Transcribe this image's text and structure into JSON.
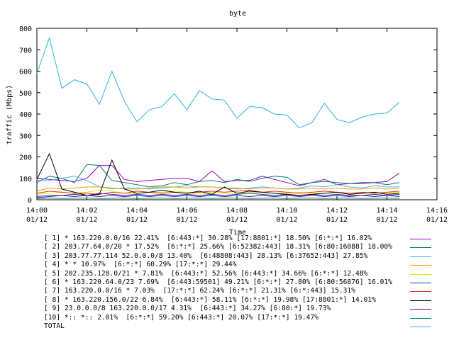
{
  "chart_data": {
    "type": "line",
    "title": "byte",
    "xlabel": "Time",
    "ylabel": "traffic (Mbps)",
    "ylim": [
      0,
      800
    ],
    "yticks": [
      "0",
      "100",
      "200",
      "300",
      "400",
      "500",
      "600",
      "700",
      "800"
    ],
    "xlim": [
      "14:00",
      "14:16"
    ],
    "xticks": [
      {
        "time": "14:00",
        "date": "01/12"
      },
      {
        "time": "14:02",
        "date": "01/12"
      },
      {
        "time": "14:04",
        "date": "01/12"
      },
      {
        "time": "14:06",
        "date": "01/12"
      },
      {
        "time": "14:08",
        "date": "01/12"
      },
      {
        "time": "14:10",
        "date": "01/12"
      },
      {
        "time": "14:12",
        "date": "01/12"
      },
      {
        "time": "14:14",
        "date": "01/12"
      },
      {
        "time": "14:16",
        "date": "01/12"
      }
    ],
    "x": [
      "14:00:00",
      "14:00:30",
      "14:01:00",
      "14:01:30",
      "14:02:00",
      "14:02:30",
      "14:03:00",
      "14:03:30",
      "14:04:00",
      "14:04:30",
      "14:05:00",
      "14:05:30",
      "14:06:00",
      "14:06:30",
      "14:07:00",
      "14:07:30",
      "14:08:00",
      "14:08:30",
      "14:09:00",
      "14:09:30",
      "14:10:00",
      "14:10:30",
      "14:11:00",
      "14:11:30",
      "14:12:00",
      "14:12:30",
      "14:13:00",
      "14:13:30",
      "14:14:00",
      "14:14:30"
    ],
    "legend_position": "bottom",
    "grid": false,
    "series": [
      {
        "name": "[ 1] * 163.220.0.0/16 22.41%  [6:443:*] 30.28% [17:8801:*] 18.50% [6:*:*] 16.02%",
        "color": "#a000c0",
        "values": [
          100,
          95,
          90,
          85,
          100,
          160,
          160,
          95,
          85,
          90,
          95,
          100,
          100,
          85,
          135,
          85,
          90,
          90,
          110,
          95,
          80,
          65,
          80,
          95,
          70,
          75,
          80,
          80,
          85,
          125
        ]
      },
      {
        "name": "[ 2] 203.77.64.0/20 * 17.52%  [6:*:*] 25.66% [6:52382:443] 18.31% [6:80:16088] 18.00%",
        "color": "#008060",
        "values": [
          80,
          110,
          100,
          80,
          165,
          160,
          90,
          80,
          70,
          60,
          65,
          80,
          70,
          85,
          90,
          80,
          95,
          85,
          100,
          110,
          105,
          70,
          80,
          85,
          80,
          75,
          75,
          80,
          70,
          80
        ]
      },
      {
        "name": "[ 3] 203.77.77.114 52.0.0.0/8 13.40%  [6:48808:443] 28.13% [6:37652:443] 27.85%",
        "color": "#50b0f0",
        "values": [
          90,
          90,
          100,
          110,
          90,
          60,
          50,
          55,
          55,
          50,
          55,
          60,
          65,
          60,
          60,
          55,
          50,
          55,
          60,
          55,
          50,
          55,
          65,
          60,
          70,
          60,
          55,
          65,
          60,
          60
        ]
      },
      {
        "name": "[ 4] * * 10.97%  [6:*:*] 60.29% [17:*:*] 29.44%",
        "color": "#f0a000",
        "values": [
          40,
          55,
          50,
          55,
          60,
          60,
          55,
          50,
          50,
          55,
          60,
          60,
          55,
          60,
          60,
          55,
          55,
          50,
          55,
          55,
          50,
          50,
          55,
          50,
          55,
          50,
          50,
          55,
          50,
          55
        ]
      },
      {
        "name": "[ 5] 202.235.128.0/21 * 7.81%  [6:443:*] 52.56% [6:443:*] 34.66% [6:*:*] 12.48%",
        "color": "#e8e800",
        "values": [
          25,
          30,
          35,
          30,
          35,
          45,
          40,
          30,
          30,
          35,
          35,
          40,
          35,
          30,
          35,
          30,
          30,
          35,
          35,
          30,
          30,
          35,
          30,
          30,
          35,
          30,
          30,
          35,
          30,
          35
        ]
      },
      {
        "name": "[ 6] * 163.220.64.0/23 7.69%  [6:443:59501] 49.21% [6:*:*] 27.80% [6:80:56876] 16.01%",
        "color": "#0050a0",
        "values": [
          15,
          20,
          20,
          25,
          20,
          30,
          25,
          20,
          25,
          20,
          25,
          20,
          25,
          20,
          25,
          20,
          25,
          30,
          25,
          20,
          25,
          20,
          25,
          20,
          25,
          20,
          20,
          25,
          20,
          25
        ]
      },
      {
        "name": "[ 7] 163.220.0.0/16 * 7.03%  [17:*:*] 62.24% [6:*:*] 21.31% [6:*:443] 15.31%",
        "color": "#e03020",
        "values": [
          30,
          40,
          35,
          30,
          30,
          25,
          35,
          30,
          40,
          35,
          30,
          35,
          30,
          35,
          40,
          35,
          40,
          45,
          35,
          40,
          35,
          30,
          35,
          40,
          35,
          30,
          35,
          30,
          35,
          40
        ]
      },
      {
        "name": "[ 8] * 163.220.156.0/22 6.84%  [6:443:*] 58.11% [6:*:*] 19.98% [17:8801:*] 14.01%",
        "color": "#000000",
        "values": [
          95,
          215,
          50,
          35,
          20,
          25,
          185,
          50,
          30,
          35,
          45,
          35,
          30,
          40,
          25,
          60,
          30,
          40,
          35,
          30,
          25,
          20,
          25,
          30,
          35,
          25,
          30,
          35,
          25,
          30
        ]
      },
      {
        "name": "[ 9] 23.0.0.0/8 163.220.0.0/17 4.31%  [6:443:*] 34.27% [6:80:*] 19.73%",
        "color": "#7000a0",
        "values": [
          10,
          15,
          20,
          15,
          20,
          15,
          20,
          15,
          20,
          15,
          20,
          15,
          20,
          15,
          20,
          15,
          20,
          15,
          20,
          15,
          20,
          15,
          20,
          15,
          20,
          15,
          20,
          15,
          20,
          15
        ]
      },
      {
        "name": "[10] *:: *:: 2.01%  [6:*:*] 59.20% [6:443:*] 20.07% [17:*:*] 19.47%",
        "color": "#008080",
        "values": [
          5,
          8,
          6,
          7,
          8,
          6,
          7,
          8,
          6,
          7,
          8,
          6,
          7,
          8,
          6,
          7,
          8,
          6,
          7,
          8,
          6,
          7,
          8,
          6,
          7,
          8,
          6,
          7,
          8,
          6
        ]
      },
      {
        "name": "TOTAL",
        "color": "#30b0e8",
        "values": [
          590,
          755,
          520,
          560,
          540,
          445,
          600,
          460,
          365,
          420,
          435,
          495,
          420,
          510,
          470,
          465,
          380,
          435,
          430,
          400,
          395,
          335,
          360,
          450,
          375,
          360,
          385,
          400,
          405,
          455
        ]
      }
    ]
  }
}
